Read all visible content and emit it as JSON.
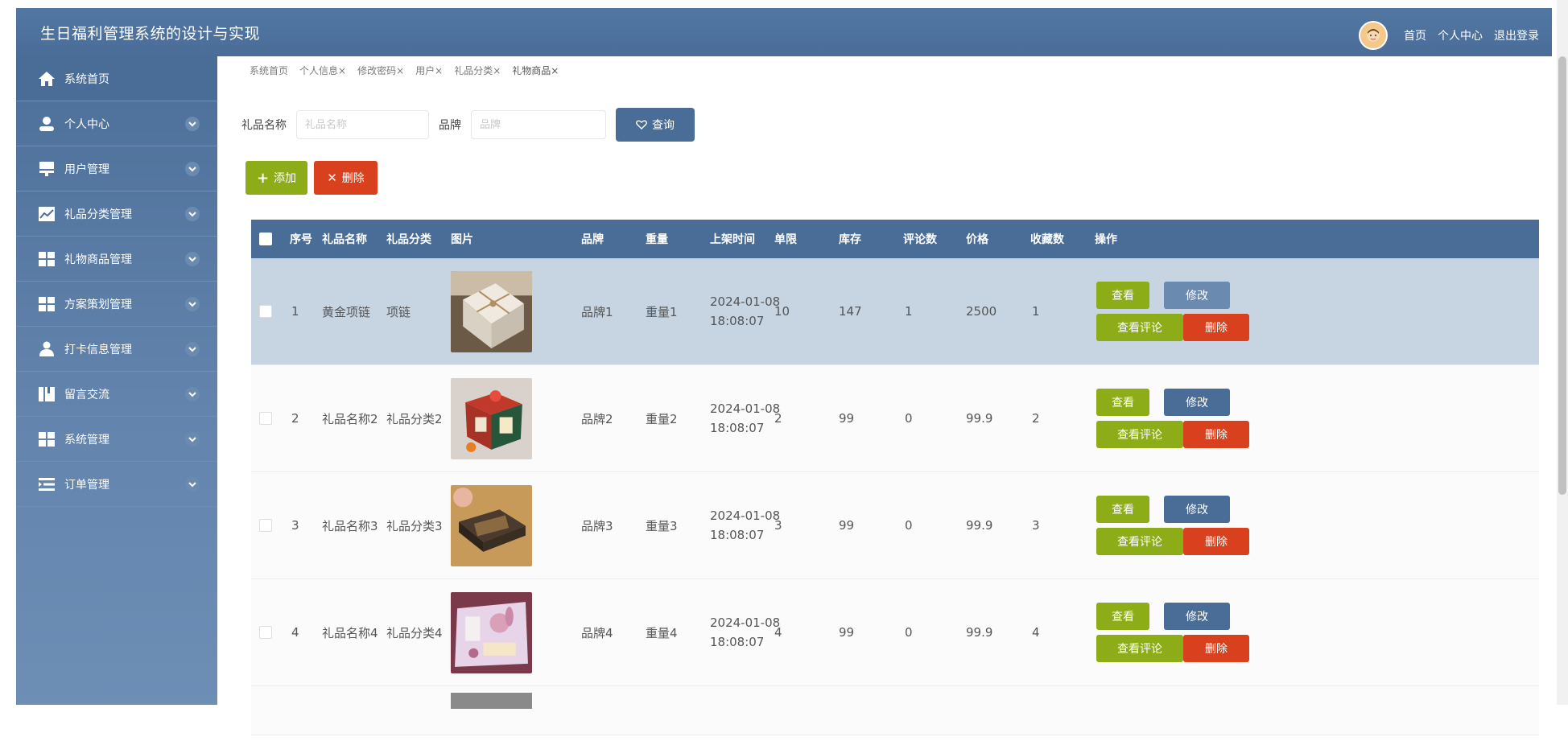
{
  "app": {
    "title": "生日福利管理系统的设计与实现"
  },
  "header": {
    "links": [
      "首页",
      "个人中心",
      "退出登录"
    ]
  },
  "sidebar": {
    "items": [
      {
        "label": "系统首页",
        "icon": "home-icon"
      },
      {
        "label": "个人中心",
        "icon": "user-icon"
      },
      {
        "label": "用户管理",
        "icon": "user-manage-icon"
      },
      {
        "label": "礼品分类管理",
        "icon": "chart-icon"
      },
      {
        "label": "礼物商品管理",
        "icon": "grid-icon"
      },
      {
        "label": "方案策划管理",
        "icon": "grid-icon"
      },
      {
        "label": "打卡信息管理",
        "icon": "person-icon"
      },
      {
        "label": "留言交流",
        "icon": "book-icon"
      },
      {
        "label": "系统管理",
        "icon": "grid-icon"
      },
      {
        "label": "订单管理",
        "icon": "list-icon"
      }
    ]
  },
  "breadcrumb": [
    "系统首页",
    "个人信息×",
    "修改密码×",
    "用户×",
    "礼品分类×",
    "礼物商品×"
  ],
  "search": {
    "name_label": "礼品名称",
    "name_placeholder": "礼品名称",
    "brand_label": "品牌",
    "brand_placeholder": "品牌",
    "query_label": "查询"
  },
  "actions": {
    "add_label": "添加",
    "delete_label": "删除"
  },
  "table": {
    "headers": [
      "序号",
      "礼品名称",
      "礼品分类",
      "图片",
      "品牌",
      "重量",
      "上架时间",
      "单限",
      "库存",
      "评论数",
      "价格",
      "收藏数",
      "操作"
    ],
    "rows": [
      {
        "no": "1",
        "name": "黄金项链",
        "category": "项链",
        "brand": "品牌1",
        "weight": "重量1",
        "date": "2024-01-08",
        "time": "18:08:07",
        "limit": "10",
        "stock": "147",
        "comments": "1",
        "price": "2500",
        "favorites": "1"
      },
      {
        "no": "2",
        "name": "礼品名称2",
        "category": "礼品分类2",
        "brand": "品牌2",
        "weight": "重量2",
        "date": "2024-01-08",
        "time": "18:08:07",
        "limit": "2",
        "stock": "99",
        "comments": "0",
        "price": "99.9",
        "favorites": "2"
      },
      {
        "no": "3",
        "name": "礼品名称3",
        "category": "礼品分类3",
        "brand": "品牌3",
        "weight": "重量3",
        "date": "2024-01-08",
        "time": "18:08:07",
        "limit": "3",
        "stock": "99",
        "comments": "0",
        "price": "99.9",
        "favorites": "3"
      },
      {
        "no": "4",
        "name": "礼品名称4",
        "category": "礼品分类4",
        "brand": "品牌4",
        "weight": "重量4",
        "date": "2024-01-08",
        "time": "18:08:07",
        "limit": "4",
        "stock": "99",
        "comments": "0",
        "price": "99.9",
        "favorites": "4"
      }
    ],
    "row_actions": {
      "view": "查看",
      "edit": "修改",
      "view_comments": "查看评论",
      "delete": "删除"
    }
  },
  "colors": {
    "primary": "#4a6d97",
    "success": "#8dad18",
    "danger": "#d9401e",
    "selected_row": "#c7d4e2"
  }
}
